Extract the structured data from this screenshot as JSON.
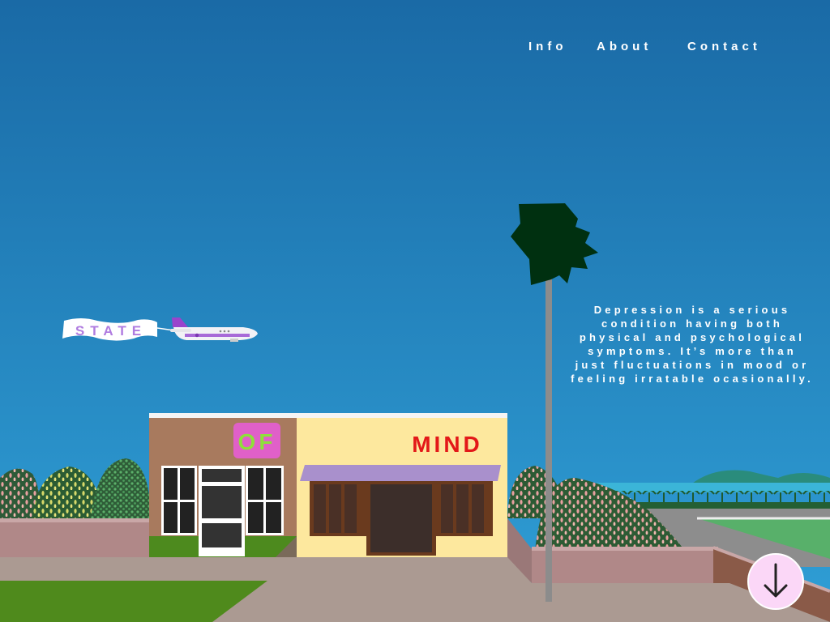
{
  "nav": {
    "info": "Info",
    "about": "About",
    "contact": "Contact"
  },
  "banner": {
    "text": "STATE"
  },
  "store_signs": {
    "of": "OF",
    "mind": "MIND"
  },
  "description": "Depression is a serious condition having both physical and psychological symptoms. It’s more than just fluctuations in mood or feeling irratable ocasionally.",
  "scroll_down": {
    "icon": "arrow-down-icon"
  },
  "colors": {
    "sky_top": "#1a6aa6",
    "sky_bottom": "#2f9fd6",
    "of_sign": "#e060c8",
    "of_text": "#8ee03a",
    "mind_text": "#e31818",
    "awning": "#a990cc",
    "down_button": "#fbd7f7"
  }
}
